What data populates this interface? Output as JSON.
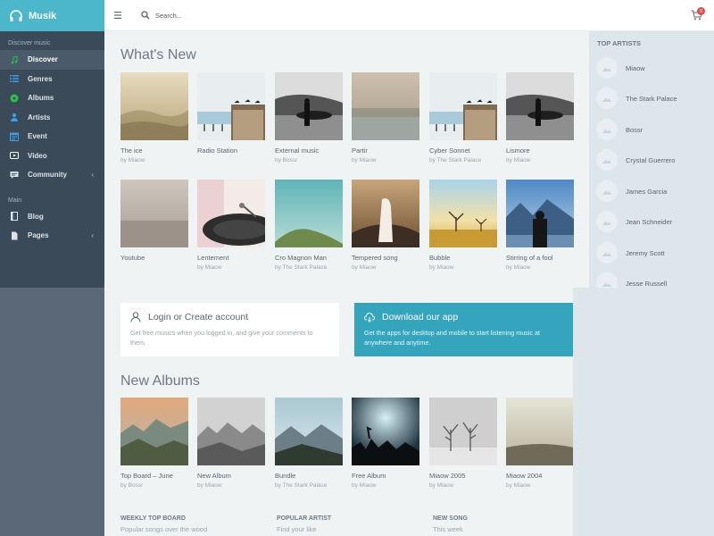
{
  "brand": {
    "name": "Musik"
  },
  "sidebar": {
    "section1": "Discover music",
    "items": [
      {
        "label": "Discover"
      },
      {
        "label": "Genres"
      },
      {
        "label": "Albums"
      },
      {
        "label": "Artists"
      },
      {
        "label": "Event"
      },
      {
        "label": "Video"
      },
      {
        "label": "Community"
      }
    ],
    "section2": "Main",
    "items2": [
      {
        "label": "Blog"
      },
      {
        "label": "Pages"
      }
    ]
  },
  "header": {
    "search_placeholder": "Search...",
    "cart_count": "0"
  },
  "whats_new": {
    "title": "What's New",
    "cards": [
      {
        "title": "The ice",
        "artist": "by Miaow"
      },
      {
        "title": "Radio Station",
        "artist": ""
      },
      {
        "title": "External music",
        "artist": "by Bossr"
      },
      {
        "title": "Partir",
        "artist": "by Miaow"
      },
      {
        "title": "Cyber Sonnet",
        "artist": "by The Stark Palace"
      },
      {
        "title": "Lismore",
        "artist": "by Miaow"
      },
      {
        "title": "Youtube",
        "artist": ""
      },
      {
        "title": "Lentement",
        "artist": "by Miaow"
      },
      {
        "title": "Cro Magnon Man",
        "artist": "by The Stark Palace"
      },
      {
        "title": "Tempered song",
        "artist": "by Miaow"
      },
      {
        "title": "Bubble",
        "artist": "by Miaow"
      },
      {
        "title": "Stirring of a fool",
        "artist": "by Miaow"
      }
    ]
  },
  "login": {
    "title": "Login or Create account",
    "desc": "Get free musics when you logged in, and give your comments to them."
  },
  "download": {
    "title": "Download our app",
    "desc": "Get the apps for desktop and mobile to start listening music at anywhere and anytime."
  },
  "new_albums": {
    "title": "New Albums",
    "cards": [
      {
        "title": "Top Board – June",
        "artist": "by Bossr"
      },
      {
        "title": "New Album",
        "artist": "by Miaow"
      },
      {
        "title": "Bundle",
        "artist": "by The Stark Palace"
      },
      {
        "title": "Free Album",
        "artist": "by Miaow"
      },
      {
        "title": "Miaow 2005",
        "artist": "by Miaow"
      },
      {
        "title": "Miaow 2004",
        "artist": "by Miaow"
      }
    ]
  },
  "footer_cols": [
    {
      "heading": "WEEKLY TOP BOARD",
      "sub": "Popular songs over the wood"
    },
    {
      "heading": "POPULAR ARTIST",
      "sub": "Find your like"
    },
    {
      "heading": "NEW SONG",
      "sub": "This week"
    }
  ],
  "top_artists": {
    "title": "TOP ARTISTS",
    "items": [
      {
        "name": "Miaow"
      },
      {
        "name": "The Stark Palace"
      },
      {
        "name": "Bossr"
      },
      {
        "name": "Crystal Guerrero"
      },
      {
        "name": "James Garcia"
      },
      {
        "name": "Jean Schneider"
      },
      {
        "name": "Jeremy Scott"
      },
      {
        "name": "Jesse Russell"
      }
    ]
  },
  "colors": {
    "brand": "#4cb6cb",
    "sidebar": "#3a4a58",
    "accent_panel": "#35a5bd",
    "active_icon": "#27c24c",
    "badge": "#e24b4b"
  }
}
